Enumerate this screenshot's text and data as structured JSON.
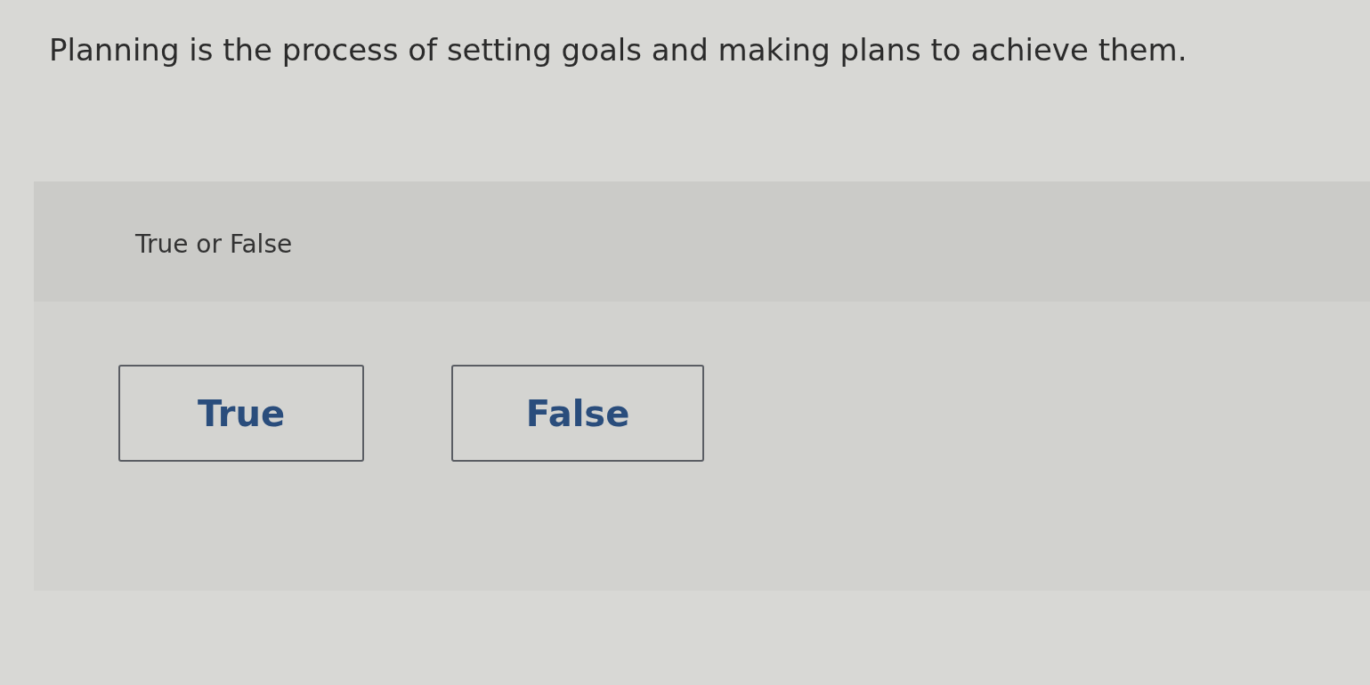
{
  "question": "Planning is the process of setting goals and making plans to achieve them.",
  "panel": {
    "prompt": "True or False",
    "options": [
      {
        "label": "True",
        "selected": false
      },
      {
        "label": "False",
        "selected": false
      }
    ]
  }
}
